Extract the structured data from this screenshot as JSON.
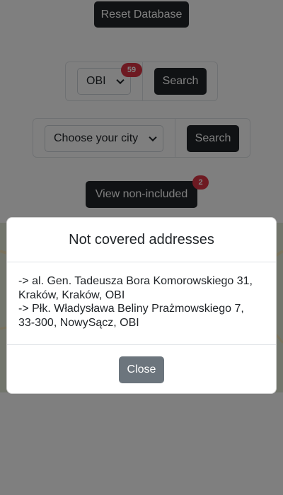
{
  "toolbar": {
    "reset_label": "Reset Database"
  },
  "store_search": {
    "selected_store": "OBI",
    "store_count_badge": "59",
    "search_label": "Search"
  },
  "city_search": {
    "city_placeholder": "Choose your city",
    "search_label": "Search"
  },
  "non_included": {
    "button_label": "View non-included",
    "count_badge": "2"
  },
  "modal": {
    "title": "Not covered addresses",
    "addresses": [
      {
        "line1": "-> al. Gen. Tadeusza Bora Komorowskiego 31,",
        "line2": "Kraków, Kraków, OBI"
      },
      {
        "line1": "-> Płk. Władysława Beliny Prażmowskiego 7,",
        "line2": "33-300, NowySącz, OBI"
      }
    ],
    "close_label": "Close"
  },
  "colors": {
    "dark_button": "#212529",
    "badge": "#dc3545",
    "close_button": "#6c757d",
    "backdrop": "rgba(0,0,0,0.5)"
  }
}
